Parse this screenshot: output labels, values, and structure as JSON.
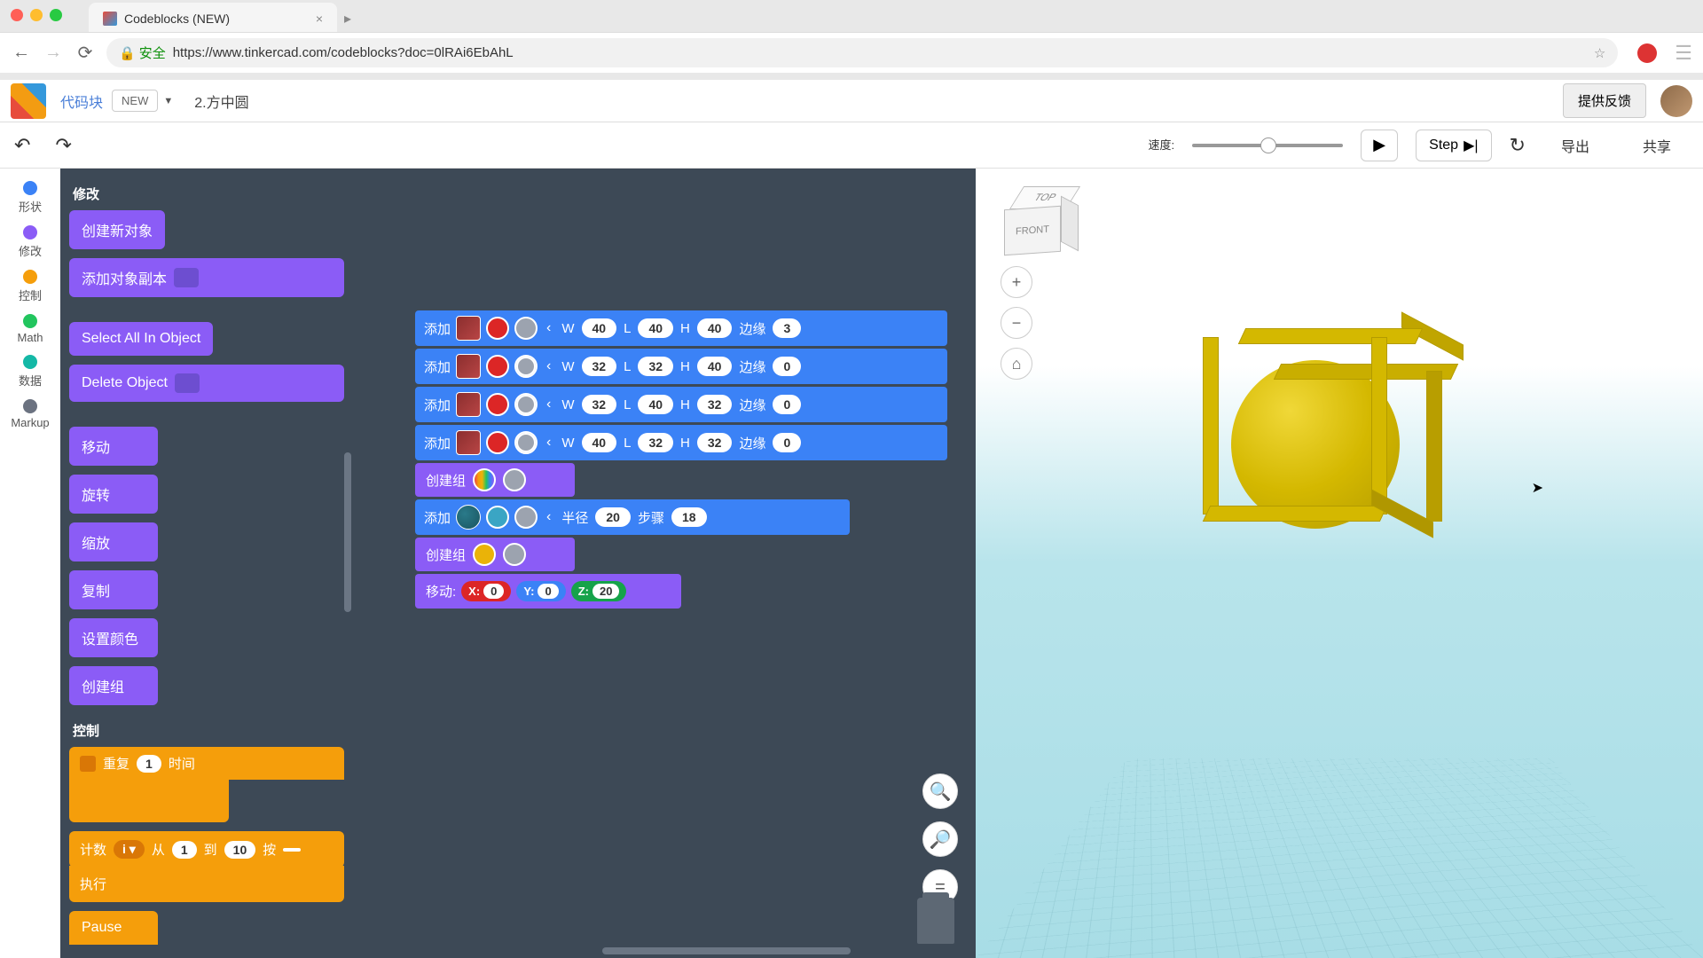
{
  "browser": {
    "tab_title": "Codeblocks (NEW)",
    "url": "https://www.tinkercad.com/codeblocks?doc=0lRAi6EbAhL",
    "secure_label": "安全"
  },
  "header": {
    "app_label": "代码块",
    "new_badge": "NEW",
    "project_name": "2.方中圆",
    "feedback": "提供反馈"
  },
  "toolbar": {
    "speed_label": "速度:",
    "step_label": "Step",
    "export_label": "导出",
    "share_label": "共享"
  },
  "categories": [
    {
      "name": "形状",
      "color": "cat-blue"
    },
    {
      "name": "修改",
      "color": "cat-purple"
    },
    {
      "name": "控制",
      "color": "cat-orange"
    },
    {
      "name": "Math",
      "color": "cat-green"
    },
    {
      "name": "数据",
      "color": "cat-teal"
    },
    {
      "name": "Markup",
      "color": "cat-gray"
    }
  ],
  "palette": {
    "section_modify": "修改",
    "section_control": "控制",
    "create_object": "创建新对象",
    "add_copy": "添加对象副本",
    "select_all": "Select All In Object",
    "delete_object": "Delete Object",
    "move": "移动",
    "rotate": "旋转",
    "scale": "缩放",
    "copy": "复制",
    "set_color": "设置颜色",
    "create_group": "创建组",
    "repeat": "重复",
    "repeat_times": "时间",
    "repeat_count": "1",
    "count": "计数",
    "count_var": "i ▾",
    "from": "从",
    "from_val": "1",
    "to": "到",
    "to_val": "10",
    "by": "按",
    "execute": "执行",
    "pause": "Pause"
  },
  "workspace": {
    "add_label": "添加",
    "create_group_label": "创建组",
    "move_label": "移动:",
    "param_W": "W",
    "param_L": "L",
    "param_H": "H",
    "param_edge": "边缘",
    "param_radius": "半径",
    "param_steps": "步骤",
    "blocks": [
      {
        "type": "add_cube",
        "w": "40",
        "l": "40",
        "h": "40",
        "edge": "3"
      },
      {
        "type": "add_cube",
        "w": "32",
        "l": "32",
        "h": "40",
        "edge": "0"
      },
      {
        "type": "add_cube",
        "w": "32",
        "l": "40",
        "h": "32",
        "edge": "0"
      },
      {
        "type": "add_cube",
        "w": "40",
        "l": "32",
        "h": "32",
        "edge": "0"
      }
    ],
    "sphere": {
      "radius": "20",
      "steps": "18"
    },
    "move_coords": {
      "x_label": "X:",
      "x": "0",
      "y_label": "Y:",
      "y": "0",
      "z_label": "Z:",
      "z": "20"
    }
  },
  "viewport": {
    "orientation_front": "FRONT",
    "orientation_top": "TOP"
  }
}
